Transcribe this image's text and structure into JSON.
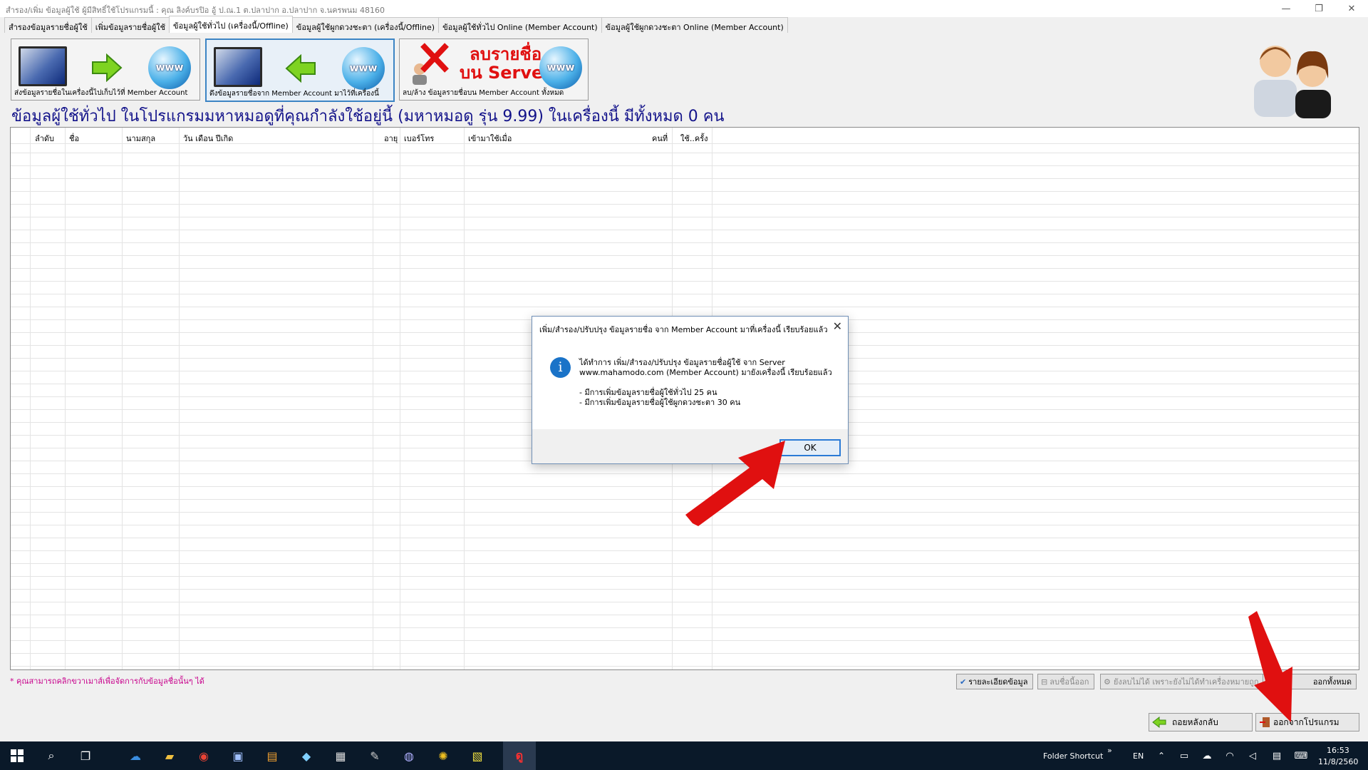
{
  "window": {
    "title": "สำรอง/เพิ่ม ข้อมูลผู้ใช้ ผู้มีสิทธิ์ใช้โปรแกรมนี้ : คุณ  ลิงค์บรปิอ     อู้ ป.ณ.1 ต.ปลาปาก อ.ปลาปาก จ.นครพนม 48160",
    "minimize": "—",
    "restore": "❐",
    "close": "✕"
  },
  "tabs": [
    {
      "label": "สำรองข้อมูลรายชื่อผู้ใช้"
    },
    {
      "label": "เพิ่มข้อมูลรายชื่อผู้ใช้"
    },
    {
      "label": "ข้อมูลผู้ใช้ทั่วไป (เครื่องนี้/Offline)"
    },
    {
      "label": "ข้อมูลผู้ใช้ผูกดวงชะตา (เครื่องนี้/Offline)"
    },
    {
      "label": "ข้อมูลผู้ใช้ทั่วไป Online (Member Account)"
    },
    {
      "label": "ข้อมูลผู้ใช้ผูกดวงชะตา Online (Member Account)"
    }
  ],
  "toolbar": {
    "send_label": "ส่งข้อมูลรายชื่อในเครื่องนี้ไปเก็บไว้ที่ Member Account",
    "fetch_label": "ดึงข้อมูลรายชื่อจาก Member Account มาไว้ที่เครื่องนี้",
    "delete_label": "ลบ/ล้าง ข้อมูลรายชื่อบน Member Account ทั้งหมด",
    "delete_line1": "ลบรายชื่อ",
    "delete_line2": "บน Server",
    "www": "www"
  },
  "headline": "ข้อมูลผู้ใช้ทั่วไป ในโปรแกรมมหาหมอดูที่คุณกำลังใช้อยู่นี้ (มหาหมอดู รุ่น 9.99) ในเครื่องนี้ มีทั้งหมด 0 คน",
  "table": {
    "columns": [
      "ลำดับ",
      "ชื่อ",
      "นามสกุล",
      "วัน เดือน ปีเกิด",
      "อายุ",
      "เบอร์โทร",
      "เข้ามาใช้เมื่อ",
      "คนที่",
      "ใช้..ครั้ง"
    ],
    "rows": []
  },
  "note": "* คุณสามารถคลิกขวาเมาส์เพื่อจัดการกับข้อมูลชื่อนั้นๆ ได้",
  "status_buttons": {
    "details": "รายละเอียดข้อมูล",
    "delete_name": "ลบชื่อนี้ออก",
    "disabled_msg": "ยังลบไม่ได้ เพราะยังไม่ได้ทำเครื่องหมายถูก",
    "delete_all": "ออกทั้งหมด"
  },
  "bottom_buttons": {
    "back": "ถอยหลังกลับ",
    "exit": "ออกจากโปรแกรม"
  },
  "dialog": {
    "title": "เพิ่ม/สำรอง/ปรับปรุง ข้อมูลรายชื่อ จาก Member Account มาที่เครื่องนี้ เรียบร้อยแล้ว",
    "close": "✕",
    "info": "i",
    "message": "ได้ทำการ เพิ่ม/สำรอง/ปรับปรุง ข้อมูลรายชื่อผู้ใช้ จาก Server\nwww.mahamodo.com (Member Account) มายังเครื่องนี้ เรียบร้อยแล้ว\n\n- มีการเพิ่มข้อมูลรายชื่อผู้ใช้ทั่วไป 25 คน\n- มีการเพิ่มข้อมูลรายชื่อผู้ใช้ผูกดวงชะตา 30 คน",
    "ok": "OK"
  },
  "taskbar": {
    "folder_shortcut": "Folder Shortcut",
    "chevron": "»",
    "lang": "EN",
    "time": "16:53",
    "date": "11/8/2560"
  },
  "colors": {
    "headline": "#13138a",
    "note": "#c8008c",
    "accent": "#1a73c8",
    "arrow": "#e01010",
    "taskbar": "#0a1929"
  }
}
